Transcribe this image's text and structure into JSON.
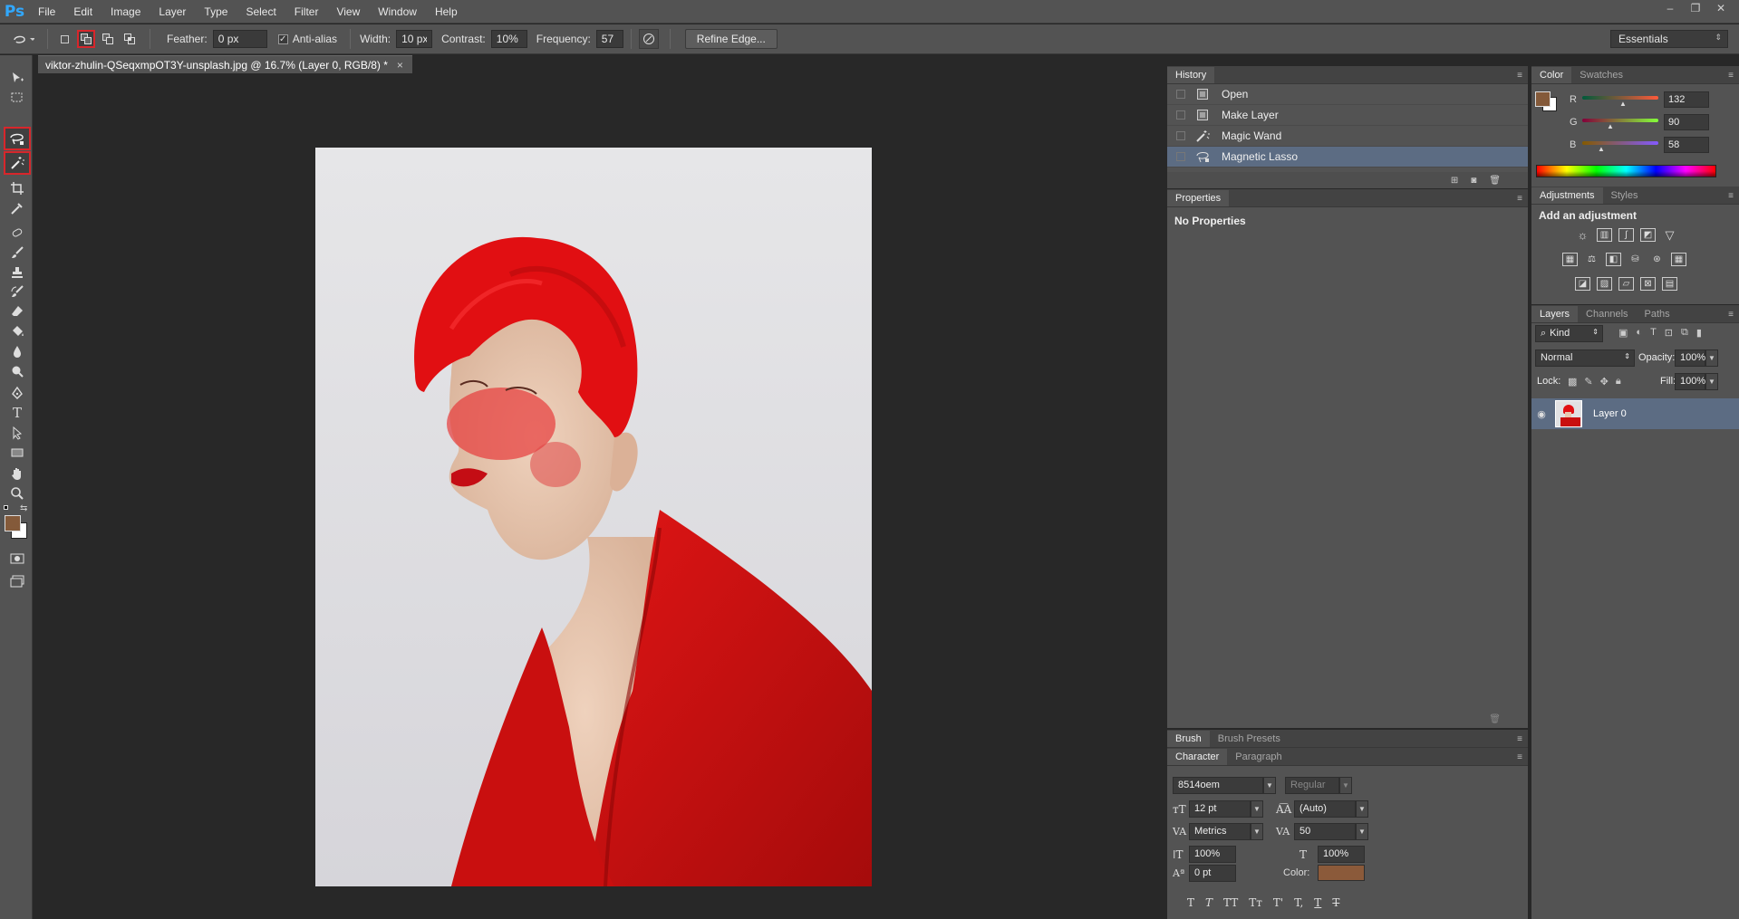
{
  "app": {
    "logo": "Ps"
  },
  "menu": [
    "File",
    "Edit",
    "Image",
    "Layer",
    "Type",
    "Select",
    "Filter",
    "View",
    "Window",
    "Help"
  ],
  "window_controls": [
    "–",
    "❐",
    "✕"
  ],
  "options": {
    "feather_label": "Feather:",
    "feather_value": "0 px",
    "antialias_label": "Anti-alias",
    "antialias_checked": true,
    "width_label": "Width:",
    "width_value": "10 px",
    "contrast_label": "Contrast:",
    "contrast_value": "10%",
    "frequency_label": "Frequency:",
    "frequency_value": "57",
    "refine_label": "Refine Edge..."
  },
  "workspace": "Essentials",
  "document": {
    "tab_title": "viktor-zhulin-QSeqxmpOT3Y-unsplash.jpg @ 16.7% (Layer 0, RGB/8) *",
    "close": "×"
  },
  "history": {
    "tab": "History",
    "items": [
      {
        "label": "Open",
        "icon": "document-icon"
      },
      {
        "label": "Make Layer",
        "icon": "document-icon"
      },
      {
        "label": "Magic Wand",
        "icon": "magic-wand-icon"
      },
      {
        "label": "Magnetic Lasso",
        "icon": "magnetic-lasso-icon",
        "selected": true
      }
    ]
  },
  "properties": {
    "tab": "Properties",
    "content": "No Properties"
  },
  "color": {
    "tabs": [
      "Color",
      "Swatches"
    ],
    "foreground": "#845a3a",
    "background": "#ffffff",
    "channels": [
      {
        "name": "R",
        "value": "132"
      },
      {
        "name": "G",
        "value": "90"
      },
      {
        "name": "B",
        "value": "58"
      }
    ]
  },
  "adjustments": {
    "tabs": [
      "Adjustments",
      "Styles"
    ],
    "heading": "Add an adjustment"
  },
  "layers": {
    "tabs": [
      "Layers",
      "Channels",
      "Paths"
    ],
    "filter": "Kind",
    "blend_mode": "Normal",
    "opacity_label": "Opacity:",
    "opacity": "100%",
    "lock_label": "Lock:",
    "fill_label": "Fill:",
    "fill": "100%",
    "items": [
      {
        "name": "Layer 0"
      }
    ]
  },
  "brush": {
    "tabs": [
      "Brush",
      "Brush Presets"
    ]
  },
  "character": {
    "tabs": [
      "Character",
      "Paragraph"
    ],
    "font": "8514oem",
    "style": "Regular",
    "size": "12 pt",
    "leading": "(Auto)",
    "kerning": "Metrics",
    "tracking": "50",
    "vscale": "100%",
    "hscale": "100%",
    "baseline": "0 pt",
    "color_label": "Color:",
    "color": "#8b5a3a",
    "styles": [
      "T",
      "T",
      "TT",
      "Tт",
      "T'",
      "T,",
      "T",
      "T"
    ]
  },
  "accent": {
    "selected_outline": "#d8262b",
    "history_selected": "#5c6c83"
  }
}
